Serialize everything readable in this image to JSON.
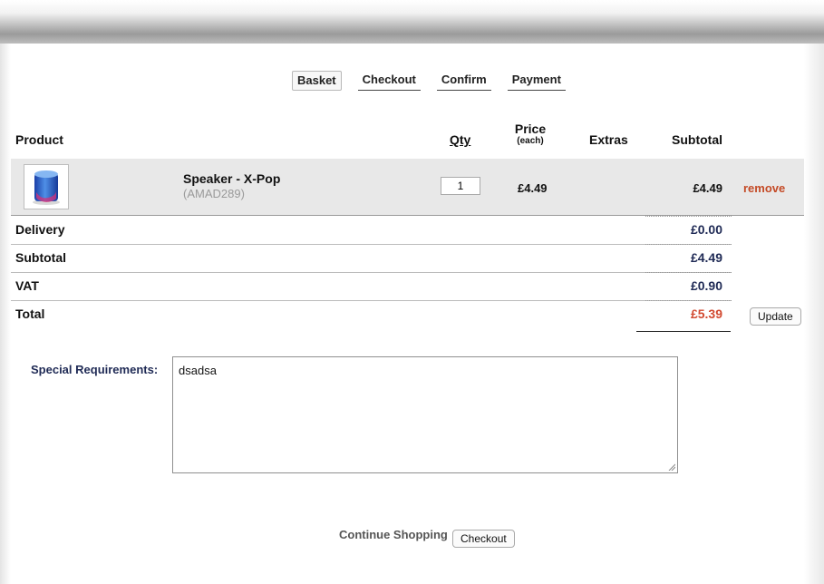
{
  "steps": [
    {
      "label": "Basket",
      "active": true
    },
    {
      "label": "Checkout",
      "active": false
    },
    {
      "label": "Confirm",
      "active": false
    },
    {
      "label": "Payment",
      "active": false
    }
  ],
  "table": {
    "headers": {
      "product": "Product",
      "qty": "Qty",
      "price": "Price",
      "price_note": "(each)",
      "extras": "Extras",
      "subtotal": "Subtotal"
    },
    "item": {
      "name": "Speaker - X-Pop",
      "code": "(AMAD289)",
      "qty": "1",
      "price": "£4.49",
      "subtotal": "£4.49",
      "remove": "remove"
    }
  },
  "totals": {
    "delivery_label": "Delivery",
    "delivery_value": "£0.00",
    "subtotal_label": "Subtotal",
    "subtotal_value": "£4.49",
    "vat_label": "VAT",
    "vat_value": "£0.90",
    "total_label": "Total",
    "total_value": "£5.39",
    "update_button": "Update"
  },
  "special": {
    "label": "Special Requirements:",
    "value": "dsadsa"
  },
  "footer": {
    "continue_label": "Continue Shopping",
    "checkout_button": "Checkout"
  },
  "colors": {
    "accent_navy": "#1f2a55",
    "remove_red": "#c44a26",
    "total_red": "#d24a31"
  }
}
